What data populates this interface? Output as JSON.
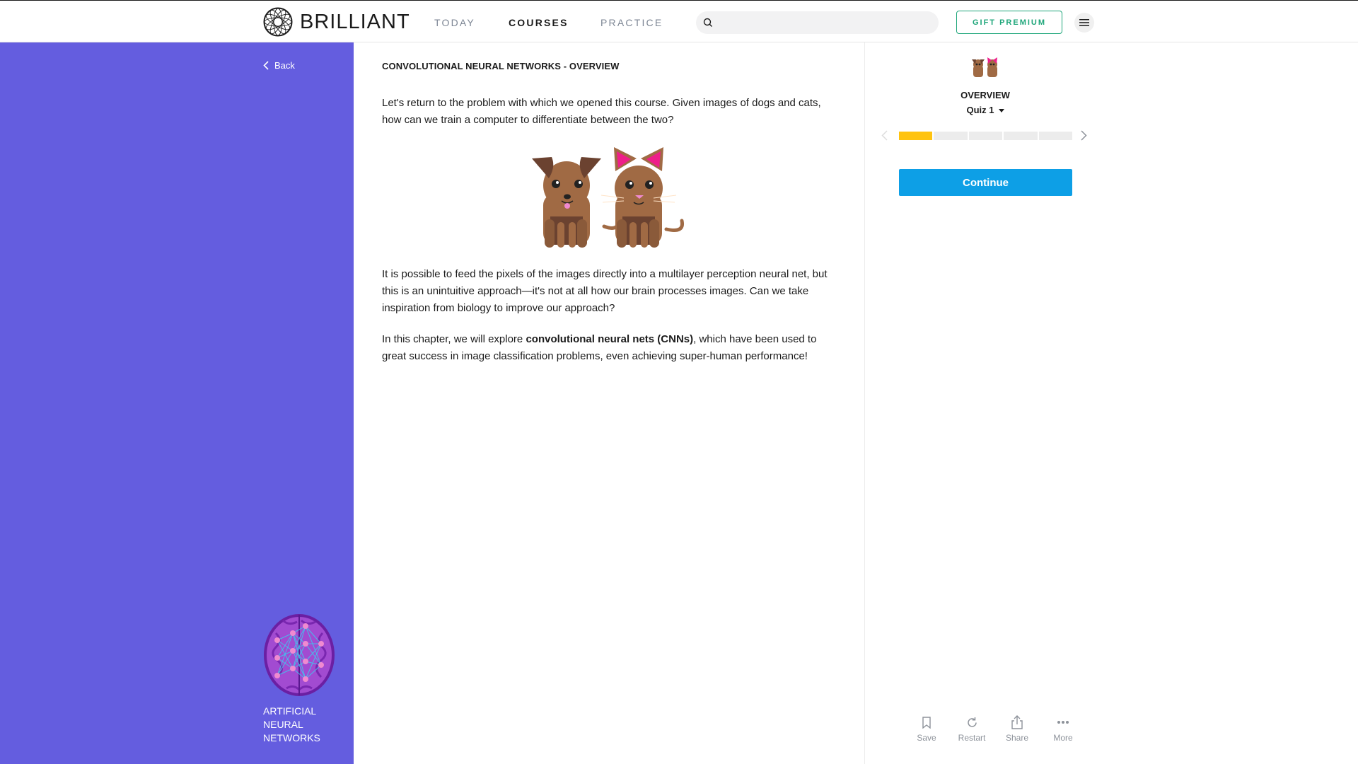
{
  "header": {
    "logo_text": "BRILLIANT",
    "nav": [
      {
        "label": "TODAY"
      },
      {
        "label": "COURSES"
      },
      {
        "label": "PRACTICE"
      }
    ],
    "search": {
      "value": "",
      "placeholder": ""
    },
    "gift_button": "GIFT PREMIUM",
    "menu_icon": "hamburger-icon"
  },
  "sidebar": {
    "back_label": "Back",
    "course_title": "ARTIFICIAL NEURAL NETWORKS",
    "background_color": "#645ddf"
  },
  "main": {
    "title": "CONVOLUTIONAL NEURAL NETWORKS - OVERVIEW",
    "paragraph1": "Let's return to the problem with which we opened this course. Given images of dogs and cats, how can we train a computer to differentiate between the two?",
    "paragraph2": "It is possible to feed the pixels of the images directly into a multilayer perception neural net, but this is an unintuitive approach—it's not at all how our brain processes images. Can we take inspiration from biology to improve our approach?",
    "paragraph3_before": "In this chapter, we will explore ",
    "paragraph3_bold": "convolutional neural nets (CNNs)",
    "paragraph3_after": ", which have been used to great success in image classification problems, even achieving super-human performance!"
  },
  "right_panel": {
    "section_title": "OVERVIEW",
    "quiz_label": "Quiz 1",
    "progress": {
      "completed_segments": 1,
      "total_segments": 5
    },
    "continue_label": "Continue",
    "actions": [
      {
        "label": "Save",
        "icon": "bookmark-icon"
      },
      {
        "label": "Restart",
        "icon": "restart-icon"
      },
      {
        "label": "Share",
        "icon": "share-icon"
      },
      {
        "label": "More",
        "icon": "more-icon"
      }
    ]
  },
  "colors": {
    "accent_green": "#1ea67a",
    "continue_blue": "#0d9fe6",
    "progress_yellow": "#ffc30f"
  }
}
